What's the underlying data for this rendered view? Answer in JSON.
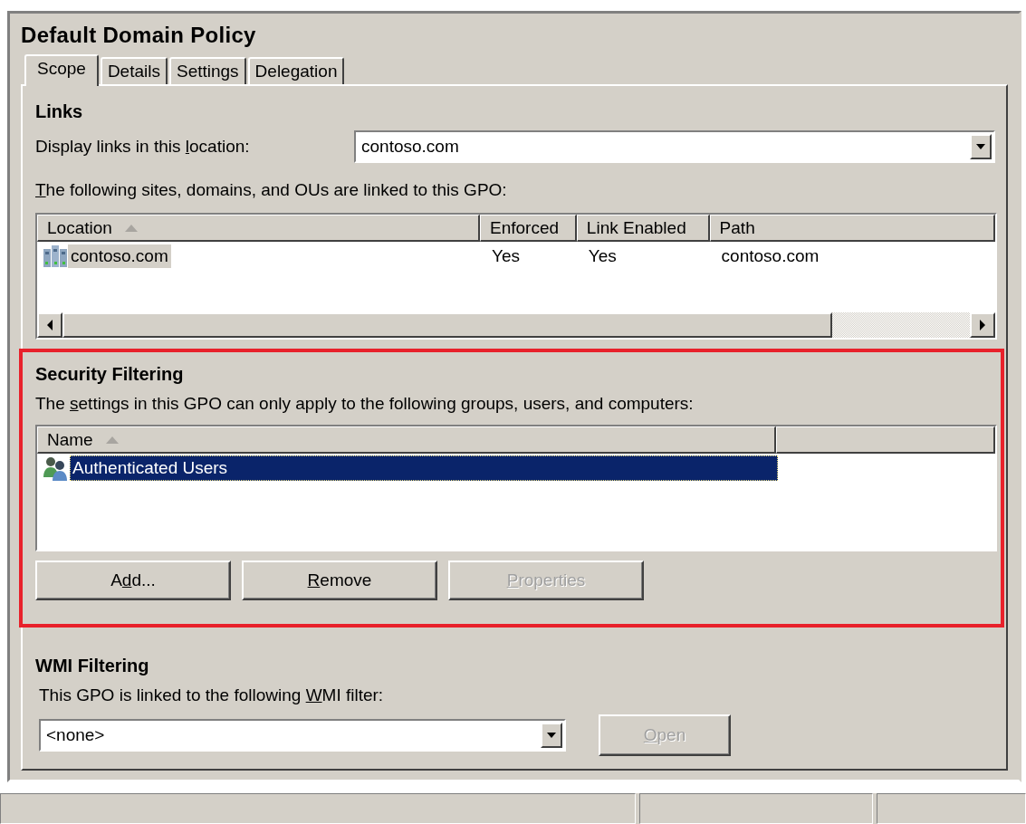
{
  "title": "Default Domain Policy",
  "tabs": [
    {
      "label": "Scope",
      "selected": true
    },
    {
      "label": "Details",
      "selected": false
    },
    {
      "label": "Settings",
      "selected": false
    },
    {
      "label": "Delegation",
      "selected": false
    }
  ],
  "links": {
    "heading": "Links",
    "location_label": {
      "pre": "Display links in this ",
      "key": "l",
      "post": "ocation:"
    },
    "location_value": "contoso.com",
    "list_label": {
      "key": "T",
      "post": "he following sites, domains, and OUs are linked to this GPO:"
    },
    "columns": [
      {
        "label": "Location",
        "sorted": true
      },
      {
        "label": "Enforced",
        "sorted": false
      },
      {
        "label": "Link Enabled",
        "sorted": false
      },
      {
        "label": "Path",
        "sorted": false
      }
    ],
    "rows": [
      {
        "cells": [
          "contoso.com",
          "Yes",
          "Yes",
          "contoso.com"
        ],
        "selected": true
      }
    ]
  },
  "security_filtering": {
    "highlighted": true,
    "heading": "Security Filtering",
    "description": {
      "pre": "The ",
      "key": "s",
      "post": "ettings in this GPO can only apply to the following groups, users, and computers:"
    },
    "columns": [
      {
        "label": "Name",
        "sorted": true
      }
    ],
    "rows": [
      {
        "name": "Authenticated Users",
        "selected": true
      }
    ],
    "buttons": [
      {
        "label": {
          "pre": "A",
          "key": "d",
          "post": "d..."
        },
        "disabled": false
      },
      {
        "label": {
          "key": "R",
          "post": "emove"
        },
        "disabled": false
      },
      {
        "label": {
          "key": "P",
          "post": "roperties"
        },
        "disabled": true
      }
    ]
  },
  "wmi_filtering": {
    "heading": "WMI Filtering",
    "description": {
      "pre": "This GPO is linked to the following ",
      "key": "W",
      "post": "MI filter:"
    },
    "filter_value": "<none>",
    "open_button": {
      "label": {
        "key": "O",
        "post": "pen"
      },
      "disabled": true
    }
  }
}
